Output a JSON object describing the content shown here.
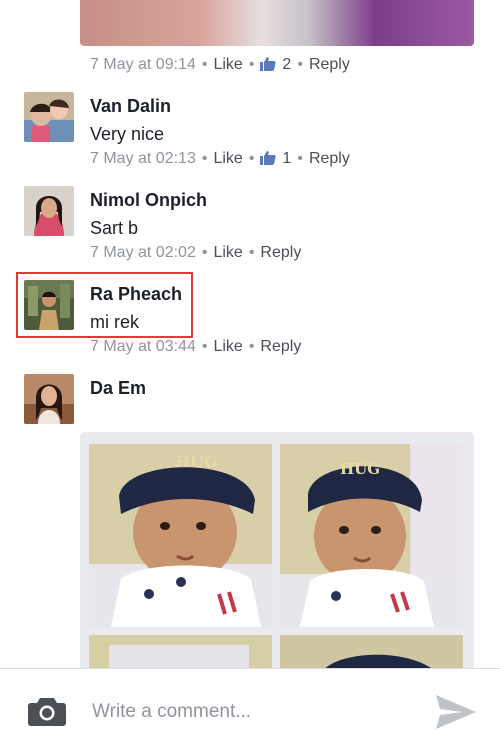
{
  "comments": [
    {
      "id": "top",
      "timestamp": "7 May at 09:14",
      "like_label": "Like",
      "reaction_count": "2",
      "reply_label": "Reply"
    },
    {
      "id": "van-dalin",
      "name": "Van Dalin",
      "text": "Very nice",
      "timestamp": "7 May at 02:13",
      "like_label": "Like",
      "reaction_count": "1",
      "reply_label": "Reply"
    },
    {
      "id": "nimol-onpich",
      "name": "Nimol Onpich",
      "text": "Sart b",
      "timestamp": "7 May at 02:02",
      "like_label": "Like",
      "reply_label": "Reply"
    },
    {
      "id": "ra-pheach",
      "name": "Ra Pheach",
      "text": "mi rek",
      "timestamp": "7 May at 03:44",
      "like_label": "Like",
      "reply_label": "Reply",
      "highlighted": true
    },
    {
      "id": "da-em",
      "name": "Da Em"
    }
  ],
  "photo_text": [
    "HUG",
    "HUG"
  ],
  "composer": {
    "placeholder": "Write a comment...",
    "camera_icon": "camera-icon",
    "send_icon": "send-icon"
  },
  "colors": {
    "meta_gray": "#90949c",
    "link_gray": "#4b4f56",
    "like_blue": "#5b7bb8",
    "highlight_red": "#e53935"
  }
}
